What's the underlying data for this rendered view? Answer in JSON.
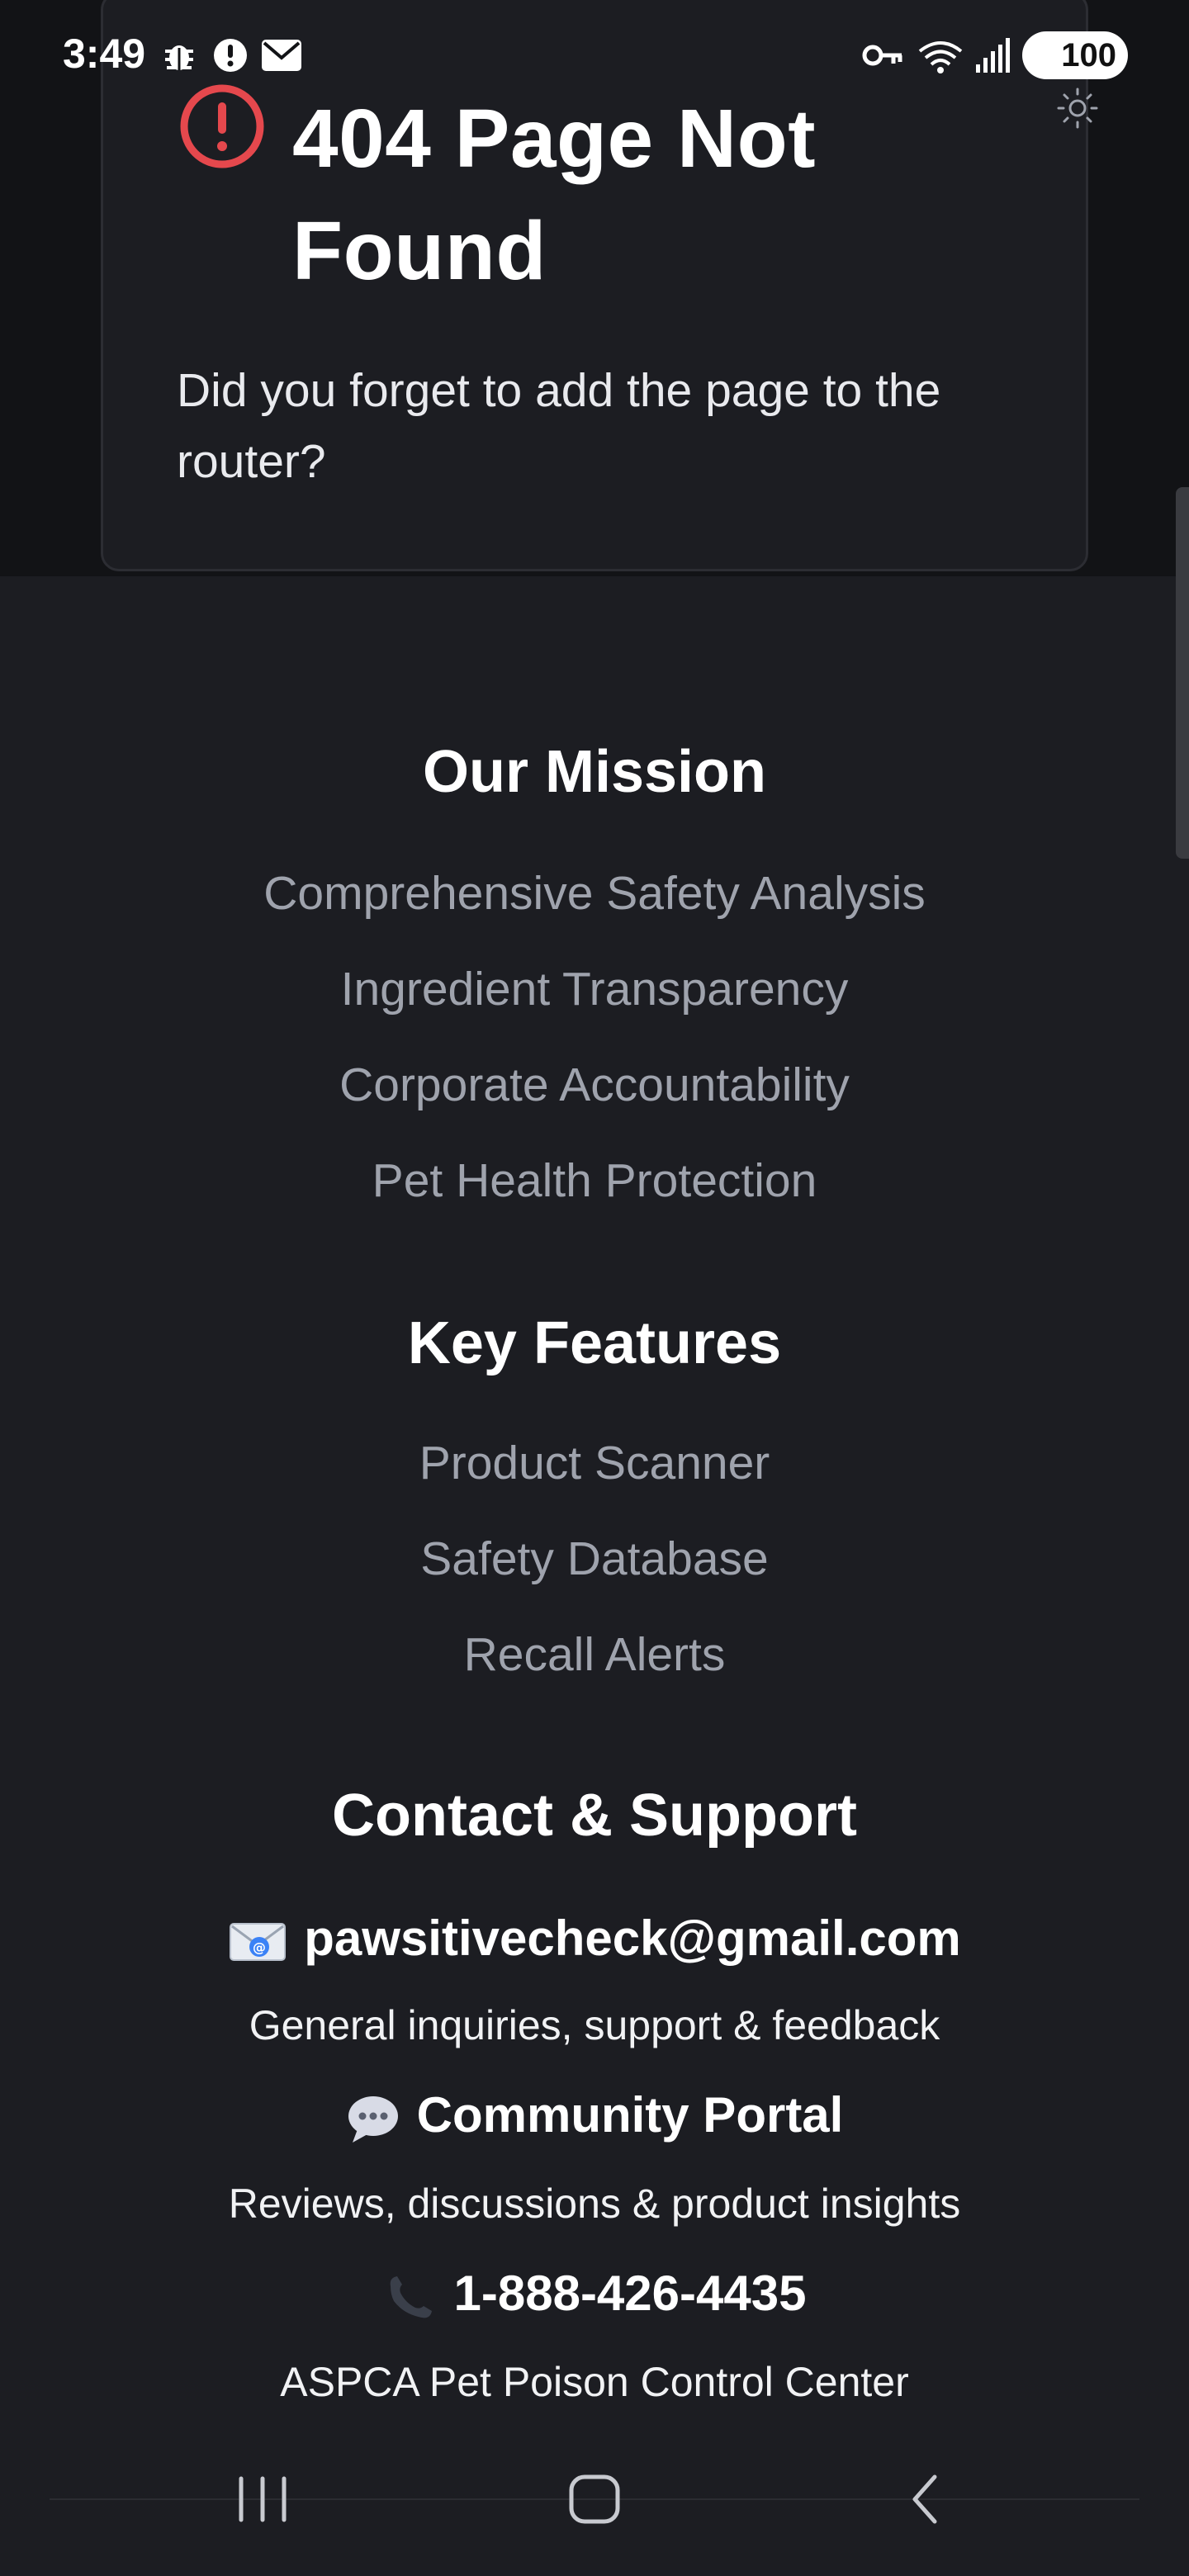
{
  "status_bar": {
    "time": "3:49",
    "battery": "100"
  },
  "error_card": {
    "title": "404 Page Not Found",
    "description": "Did you forget to add the page to the router?"
  },
  "mission": {
    "title": "Our Mission",
    "items": [
      "Comprehensive Safety Analysis",
      "Ingredient Transparency",
      "Corporate Accountability",
      "Pet Health Protection"
    ]
  },
  "features": {
    "title": "Key Features",
    "items": [
      "Product Scanner",
      "Safety Database",
      "Recall Alerts"
    ]
  },
  "contact": {
    "title": "Contact & Support",
    "entries": [
      {
        "icon": "email-icon",
        "label": "pawsitivecheck@gmail.com",
        "sub": "General inquiries, support & feedback"
      },
      {
        "icon": "speech-bubble-icon",
        "label": "Community Portal",
        "sub": "Reviews, discussions & product insights"
      },
      {
        "icon": "phone-icon",
        "label": "1-888-426-4435",
        "sub": "ASPCA Pet Poison Control Center"
      }
    ]
  },
  "colors": {
    "background": "#1c1d22",
    "error": "#e5484d",
    "muted_link": "#9fa3ad"
  }
}
